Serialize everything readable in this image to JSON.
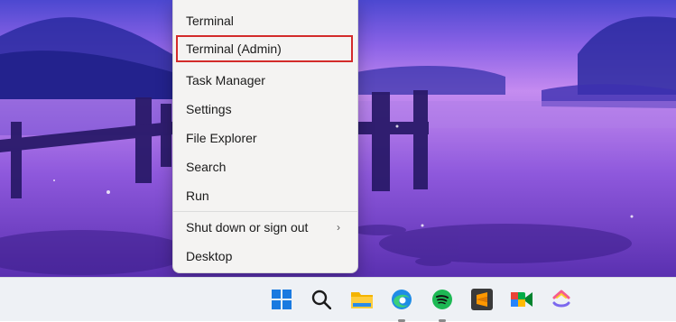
{
  "context_menu": {
    "items": [
      {
        "label": "Terminal",
        "highlighted": false,
        "has_submenu": false
      },
      {
        "label": "Terminal (Admin)",
        "highlighted": true,
        "has_submenu": false
      },
      {
        "label": "Task Manager",
        "highlighted": false,
        "has_submenu": false
      },
      {
        "label": "Settings",
        "highlighted": false,
        "has_submenu": false
      },
      {
        "label": "File Explorer",
        "highlighted": false,
        "has_submenu": false
      },
      {
        "label": "Search",
        "highlighted": false,
        "has_submenu": false
      },
      {
        "label": "Run",
        "highlighted": false,
        "has_submenu": false
      },
      {
        "label": "Shut down or sign out",
        "highlighted": false,
        "has_submenu": true,
        "submenu_glyph": "›"
      },
      {
        "label": "Desktop",
        "highlighted": false,
        "has_submenu": false
      }
    ],
    "highlight_color": "#d32b2b"
  },
  "taskbar": {
    "icons": [
      {
        "name": "windows-start-icon",
        "running": false
      },
      {
        "name": "search-icon",
        "running": false
      },
      {
        "name": "file-explorer-icon",
        "running": false
      },
      {
        "name": "edge-icon",
        "running": true
      },
      {
        "name": "spotify-icon",
        "running": true
      },
      {
        "name": "sublime-text-icon",
        "running": false
      },
      {
        "name": "google-meet-icon",
        "running": false
      },
      {
        "name": "clickup-icon",
        "running": false
      }
    ]
  },
  "colors": {
    "taskbar_bg": "#eef1f5",
    "menu_bg": "#f4f3f2",
    "windows_blue": "#1a7ae0",
    "spotify_green": "#1db954"
  }
}
